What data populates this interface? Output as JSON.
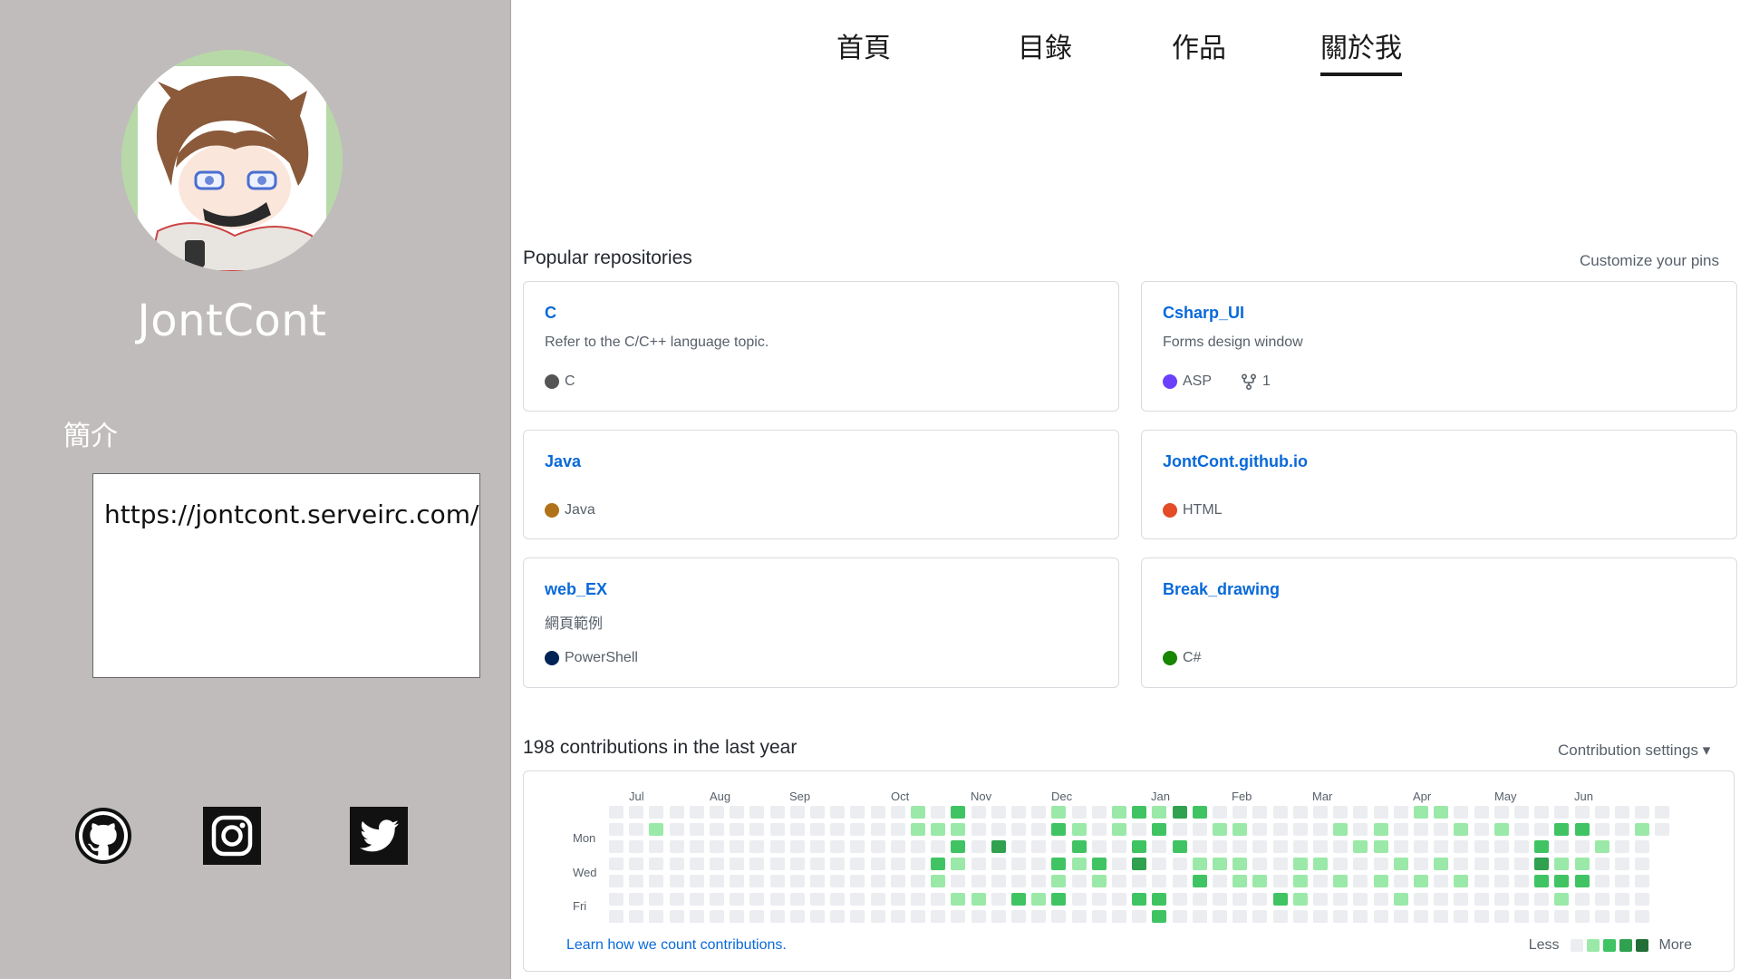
{
  "sidebar": {
    "username": "JontCont",
    "intro_label": "簡介",
    "intro_text": "https://jontcont.serveirc.com/",
    "social": [
      {
        "icon": "github-icon"
      },
      {
        "icon": "instagram-icon"
      },
      {
        "icon": "twitter-icon"
      }
    ]
  },
  "nav": {
    "items": [
      {
        "label": "首頁",
        "active": false
      },
      {
        "label": "目錄",
        "active": false
      },
      {
        "label": "作品",
        "active": false
      },
      {
        "label": "關於我",
        "active": true
      }
    ]
  },
  "repos": {
    "title": "Popular repositories",
    "customize": "Customize your pins",
    "items": [
      {
        "name": "C",
        "description": "Refer to the C/C++ language topic.",
        "language": "C",
        "color": "#555555",
        "forks": ""
      },
      {
        "name": "Csharp_UI",
        "description": "Forms design window",
        "language": "ASP",
        "color": "#6a40fd",
        "forks": "1"
      },
      {
        "name": "Java",
        "description": "",
        "language": "Java",
        "color": "#b07219",
        "forks": ""
      },
      {
        "name": "JontCont.github.io",
        "description": "",
        "language": "HTML",
        "color": "#e34c26",
        "forks": ""
      },
      {
        "name": "web_EX",
        "description": "網頁範例",
        "language": "PowerShell",
        "color": "#012456",
        "forks": ""
      },
      {
        "name": "Break_drawing",
        "description": "",
        "language": "C#",
        "color": "#178600",
        "forks": ""
      }
    ]
  },
  "contributions": {
    "title": "198 contributions in the last year",
    "settings": "Contribution settings ▾",
    "months": [
      "Jul",
      "Aug",
      "Sep",
      "Oct",
      "Nov",
      "Dec",
      "Jan",
      "Feb",
      "Mar",
      "Apr",
      "May",
      "Jun"
    ],
    "days": [
      "Mon",
      "Wed",
      "Fri"
    ],
    "learn": "Learn how we count contributions.",
    "legend_less": "Less",
    "legend_more": "More",
    "colors": [
      "#ebedf0",
      "#9be9a8",
      "#40c463",
      "#30a14e",
      "#216e39"
    ],
    "active_cells": [
      [
        2,
        1,
        1
      ],
      [
        15,
        1,
        1
      ],
      [
        16,
        1,
        1
      ],
      [
        15,
        0,
        1
      ],
      [
        16,
        3,
        2
      ],
      [
        16,
        4,
        1
      ],
      [
        17,
        0,
        2
      ],
      [
        17,
        1,
        1
      ],
      [
        17,
        2,
        2
      ],
      [
        17,
        3,
        1
      ],
      [
        17,
        5,
        1
      ],
      [
        18,
        5,
        1
      ],
      [
        19,
        2,
        3
      ],
      [
        20,
        5,
        2
      ],
      [
        21,
        5,
        1
      ],
      [
        22,
        0,
        1
      ],
      [
        22,
        1,
        2
      ],
      [
        22,
        3,
        2
      ],
      [
        22,
        4,
        1
      ],
      [
        22,
        5,
        2
      ],
      [
        23,
        1,
        1
      ],
      [
        23,
        2,
        2
      ],
      [
        23,
        3,
        1
      ],
      [
        24,
        3,
        2
      ],
      [
        24,
        4,
        1
      ],
      [
        25,
        0,
        1
      ],
      [
        25,
        1,
        1
      ],
      [
        26,
        0,
        2
      ],
      [
        26,
        2,
        2
      ],
      [
        26,
        3,
        3
      ],
      [
        26,
        5,
        2
      ],
      [
        27,
        0,
        1
      ],
      [
        27,
        1,
        2
      ],
      [
        27,
        5,
        2
      ],
      [
        27,
        6,
        2
      ],
      [
        28,
        0,
        3
      ],
      [
        28,
        2,
        2
      ],
      [
        29,
        0,
        2
      ],
      [
        29,
        3,
        1
      ],
      [
        29,
        4,
        2
      ],
      [
        30,
        1,
        1
      ],
      [
        30,
        3,
        1
      ],
      [
        31,
        1,
        1
      ],
      [
        31,
        3,
        1
      ],
      [
        31,
        4,
        1
      ],
      [
        32,
        4,
        1
      ],
      [
        33,
        5,
        2
      ],
      [
        34,
        3,
        1
      ],
      [
        34,
        4,
        1
      ],
      [
        34,
        5,
        1
      ],
      [
        35,
        3,
        1
      ],
      [
        36,
        1,
        1
      ],
      [
        36,
        4,
        1
      ],
      [
        37,
        2,
        1
      ],
      [
        38,
        1,
        1
      ],
      [
        38,
        2,
        1
      ],
      [
        38,
        4,
        1
      ],
      [
        39,
        3,
        1
      ],
      [
        39,
        5,
        1
      ],
      [
        40,
        0,
        1
      ],
      [
        40,
        4,
        1
      ],
      [
        41,
        0,
        1
      ],
      [
        41,
        3,
        1
      ],
      [
        42,
        1,
        1
      ],
      [
        42,
        4,
        1
      ],
      [
        44,
        1,
        1
      ],
      [
        46,
        2,
        2
      ],
      [
        46,
        3,
        3
      ],
      [
        46,
        4,
        2
      ],
      [
        47,
        1,
        2
      ],
      [
        47,
        3,
        1
      ],
      [
        47,
        4,
        2
      ],
      [
        47,
        5,
        1
      ],
      [
        48,
        1,
        2
      ],
      [
        48,
        3,
        1
      ],
      [
        48,
        4,
        2
      ],
      [
        49,
        2,
        1
      ],
      [
        51,
        1,
        1
      ],
      [
        52,
        6,
        1
      ],
      [
        53,
        2,
        1
      ],
      [
        54,
        5,
        1
      ],
      [
        55,
        0,
        1
      ],
      [
        55,
        1,
        1
      ]
    ]
  }
}
